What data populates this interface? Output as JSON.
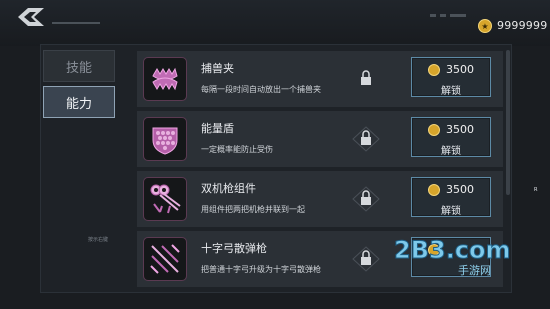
{
  "header": {
    "coins": "9999999",
    "back_icon": "back-chevron-icon",
    "coin_icon": "coin-icon"
  },
  "tabs": [
    {
      "label": "技能"
    },
    {
      "label": "能力"
    }
  ],
  "side_note": "按示右键",
  "items": [
    {
      "name": "捕兽夹",
      "desc": "每隔一段时间自动放出一个捕兽夹",
      "price": "3500",
      "button": "解锁",
      "icon": "bear-trap-icon"
    },
    {
      "name": "能量盾",
      "desc": "一定概率能防止受伤",
      "price": "3500",
      "button": "解锁",
      "icon": "energy-shield-icon"
    },
    {
      "name": "双机枪组件",
      "desc": "用组件把两把机枪并联到一起",
      "price": "3500",
      "button": "解锁",
      "icon": "twin-gun-icon"
    },
    {
      "name": "十字弓散弹枪",
      "desc": "把普通十字弓升级为十字弓散弹枪",
      "price": "",
      "button": "",
      "icon": "crossbow-icon"
    }
  ],
  "side_mark": "R",
  "watermark": {
    "main": "2B3.com",
    "sub": "手游网"
  },
  "colors": {
    "accent": "#d7a52b",
    "icon_pink": "#e08ad4",
    "button_border": "#5d8aa6"
  }
}
